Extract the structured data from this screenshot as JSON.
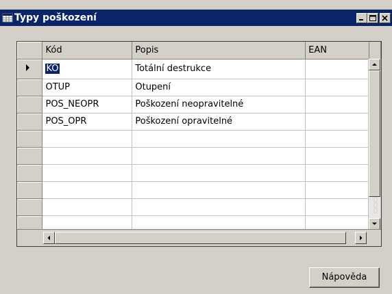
{
  "window": {
    "title": "Typy poškození"
  },
  "grid": {
    "columns": [
      {
        "label": "Kód"
      },
      {
        "label": "Popis"
      },
      {
        "label": "EAN"
      }
    ],
    "rows": [
      {
        "code": "KO",
        "description": "Totální destrukce",
        "ean": ""
      },
      {
        "code": "OTUP",
        "description": "Otupení",
        "ean": ""
      },
      {
        "code": "POS_NEOPR",
        "description": "Poškození neopravitelné",
        "ean": ""
      },
      {
        "code": "POS_OPR",
        "description": "Poškození opravitelné",
        "ean": ""
      },
      {
        "code": "",
        "description": "",
        "ean": ""
      },
      {
        "code": "",
        "description": "",
        "ean": ""
      },
      {
        "code": "",
        "description": "",
        "ean": ""
      },
      {
        "code": "",
        "description": "",
        "ean": ""
      },
      {
        "code": "",
        "description": "",
        "ean": ""
      },
      {
        "code": "",
        "description": "",
        "ean": ""
      }
    ],
    "current_row": 0
  },
  "buttons": {
    "help_label": "Nápověda"
  },
  "icons": {
    "window_icon": "table-icon",
    "minimize": "minimize-icon",
    "maximize": "maximize-icon",
    "close": "close-icon",
    "row_pointer": "row-pointer-icon",
    "scroll_up": "arrow-up-icon",
    "scroll_down": "arrow-down-icon",
    "scroll_left": "arrow-left-icon",
    "scroll_right": "arrow-right-icon"
  },
  "colors": {
    "titlebar": "#0a246a",
    "face": "#d4d0c8",
    "selection": "#0a246a"
  }
}
